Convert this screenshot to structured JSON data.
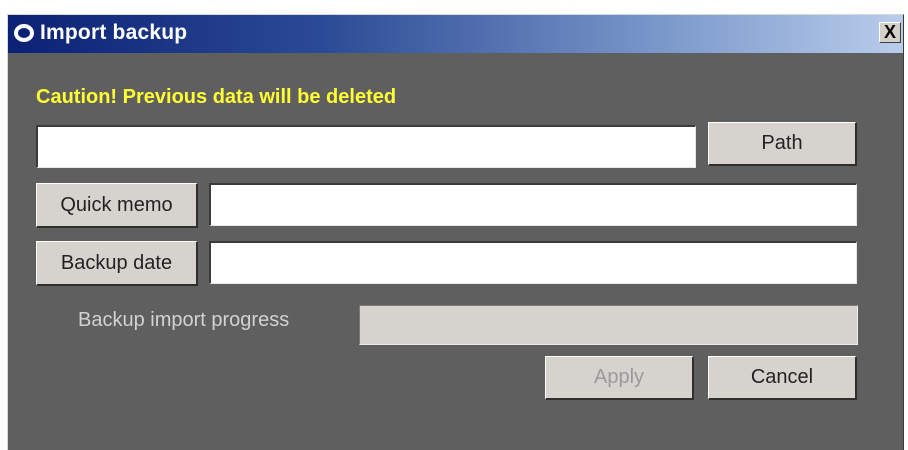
{
  "window": {
    "title": "Import backup",
    "close_label": "X"
  },
  "caution": "Caution! Previous data will be deleted",
  "path": {
    "value": "",
    "button_label": "Path"
  },
  "quick_memo": {
    "label": "Quick memo",
    "value": ""
  },
  "backup_date": {
    "label": "Backup date",
    "value": ""
  },
  "progress": {
    "label": "Backup import progress",
    "fraction": 0
  },
  "buttons": {
    "apply": "Apply",
    "cancel": "Cancel"
  },
  "colors": {
    "caution": "#ffff33",
    "dialog_bg": "#5f5f5f",
    "title_start": "#0b2175",
    "title_end": "#b9cdeb"
  }
}
